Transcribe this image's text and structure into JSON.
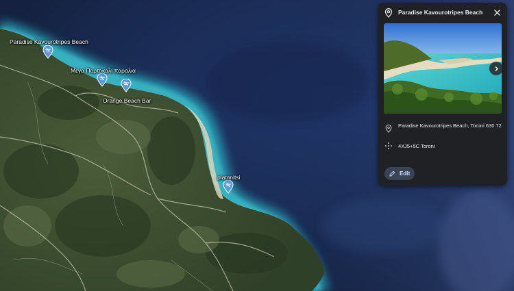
{
  "map": {
    "labels": {
      "paradise": "Paradise Kavourotripes Beach",
      "mega": "Μεγα Πορτοκαλι παραλια",
      "orange": "Orange Beach Bar",
      "platanitsi": "platanitsi"
    }
  },
  "panel": {
    "title": "Paradise Kavourotripes Beach",
    "address": "Paradise Kavourotripes Beach, Toroni 630 72",
    "plus_code": "4XJ5+5C Toroni",
    "edit_label": "Edit"
  },
  "icons": {
    "pin": "map-pin-icon",
    "close": "close-icon",
    "next": "chevron-right-icon",
    "plus_code": "plus-code-icon",
    "edit": "pencil-icon",
    "beach": "beach-icon"
  },
  "colors": {
    "panel_bg": "#202124",
    "accent": "#394457",
    "marker": "#5a9bd6",
    "sea": "#1c2f58",
    "shallow": "#2aa3b8",
    "land": "#3f5232"
  }
}
